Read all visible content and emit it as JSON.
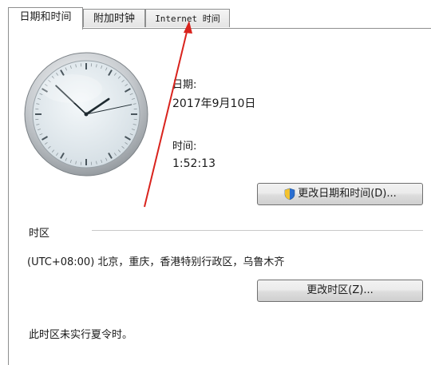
{
  "tabs": [
    {
      "label": "日期和时间",
      "active": true
    },
    {
      "label": "附加时钟",
      "active": false
    },
    {
      "label": "Internet 时间",
      "active": false
    }
  ],
  "date": {
    "label": "日期:",
    "value": "2017年9月10日"
  },
  "time": {
    "label": "时间:",
    "value": "1:52:13"
  },
  "clock": {
    "hour": 1,
    "minute": 52,
    "second": 13
  },
  "change_datetime_button": "更改日期和时间(D)...",
  "timezone": {
    "section_label": "时区",
    "value": "(UTC+08:00) 北京，重庆，香港特别行政区，乌鲁木齐",
    "change_button": "更改时区(Z)...",
    "dst_note": "此时区未实行夏令时。"
  },
  "colors": {
    "annotation_arrow": "#d9231d",
    "clock_face": "#e6edf1"
  }
}
